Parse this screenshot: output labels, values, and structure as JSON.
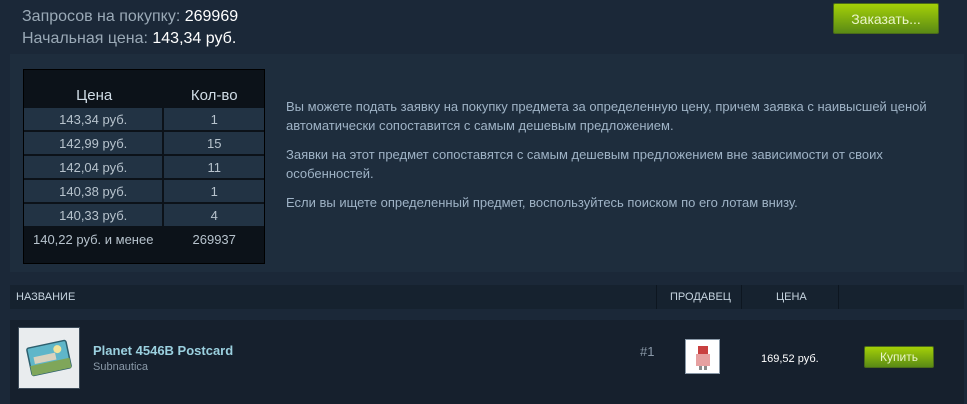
{
  "summary": {
    "requests_label": "Запросов на покупку:",
    "requests_value": "269969",
    "start_price_label": "Начальная цена:",
    "start_price_value": "143,34 руб."
  },
  "order_button_label": "Заказать...",
  "orders_table": {
    "headers": [
      "Цена",
      "Кол-во"
    ],
    "rows": [
      {
        "price": "143,34 руб.",
        "qty": "1"
      },
      {
        "price": "142,99 руб.",
        "qty": "15"
      },
      {
        "price": "142,04 руб.",
        "qty": "11"
      },
      {
        "price": "140,38 руб.",
        "qty": "1"
      },
      {
        "price": "140,33 руб.",
        "qty": "4"
      },
      {
        "price": "140,22 руб. и менее",
        "qty": "269937"
      }
    ]
  },
  "info_paragraphs": [
    "Вы можете подать заявку на покупку предмета за определенную цену, причем заявка с наивысшей ценой автоматически сопоставится с самым дешевым предложением.",
    "Заявки на этот предмет сопоставятся с самым дешевым предложением вне зависимости от своих особенностей.",
    "Если вы ищете определенный предмет, воспользуйтесь поиском по его лотам внизу."
  ],
  "listing_header": {
    "name": "НАЗВАНИЕ",
    "seller": "ПРОДАВЕЦ",
    "price": "ЦЕНА"
  },
  "listing": {
    "item_name": "Planet 4546B Postcard",
    "game": "Subnautica",
    "rank": "#1",
    "price": "169,52 руб.",
    "buy_label": "Купить",
    "thumbnail_icon": "postcard-icon",
    "seller_icon": "seller-avatar-icon"
  },
  "colors": {
    "background": "#1b2838",
    "panel": "#1e2d3d",
    "button_green": "#5a8a15",
    "item_name": "#9bd0df"
  }
}
